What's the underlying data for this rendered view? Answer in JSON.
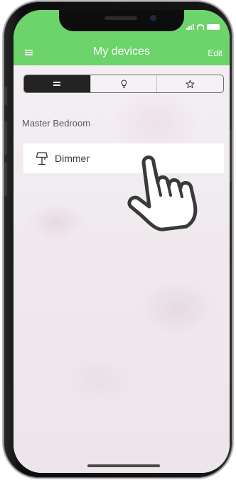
{
  "header": {
    "title": "My devices",
    "edit_label": "Edit",
    "menu_icon": "menu-icon",
    "bar_color": "#6cd46a"
  },
  "tabs": [
    {
      "icon": "list-icon",
      "selected": true
    },
    {
      "icon": "lightbulb-icon",
      "selected": false
    },
    {
      "icon": "star-icon",
      "selected": false
    }
  ],
  "room": {
    "name": "Master Bedroom",
    "devices": [
      {
        "name": "Dimmer",
        "icon": "lamp-icon"
      }
    ]
  },
  "overlay": {
    "icon": "pointing-hand-icon"
  }
}
